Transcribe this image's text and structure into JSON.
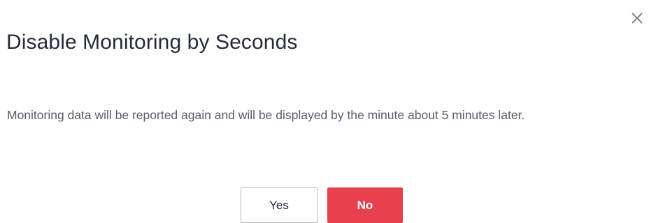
{
  "dialog": {
    "title": "Disable Monitoring by Seconds",
    "message": "Monitoring data will be reported again and will be displayed by the minute about 5 minutes later.",
    "close_icon": "close-icon",
    "buttons": {
      "yes_label": "Yes",
      "no_label": "No"
    }
  },
  "colors": {
    "danger": "#e6414d",
    "title_text": "#252b3a",
    "body_text": "#575d6c",
    "border": "#b3b6bd"
  }
}
